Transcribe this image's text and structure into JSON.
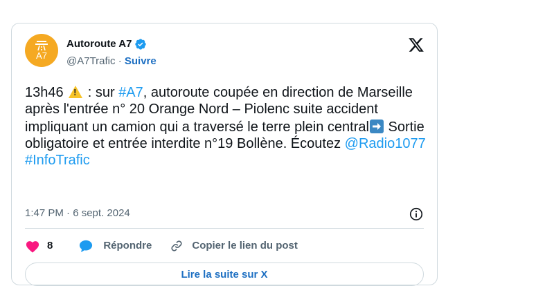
{
  "author": {
    "name": "Autoroute A7",
    "handle": "@A7Trafic",
    "separator": " · ",
    "follow_label": "Suivre",
    "avatar_text": "A7",
    "avatar_color": "#f5a922",
    "verified": true
  },
  "tweet": {
    "segments": [
      {
        "type": "text",
        "value": "13h46 "
      },
      {
        "type": "emoji",
        "icon": "warning-icon"
      },
      {
        "type": "text",
        "value": " : sur "
      },
      {
        "type": "link",
        "value": "#A7"
      },
      {
        "type": "text",
        "value": ", autoroute coupée en direction de Marseille après l'entrée n° 20 Orange Nord – Piolenc suite accident impliquant un camion qui a traversé le terre plein central"
      },
      {
        "type": "emoji",
        "icon": "right-arrow-icon"
      },
      {
        "type": "text",
        "value": " Sortie obligatoire et entrée interdite n°19 Bollène. Écoutez "
      },
      {
        "type": "link",
        "value": "@Radio1077"
      },
      {
        "type": "text",
        "value": " "
      },
      {
        "type": "link",
        "value": "#InfoTrafic"
      }
    ],
    "timestamp": "1:47 PM · 6 sept. 2024"
  },
  "actions": {
    "like_count": "8",
    "reply_label": "Répondre",
    "copy_link_label": "Copier le lien du post"
  },
  "read_more_label": "Lire la suite sur X",
  "colors": {
    "link": "#1d9bf0",
    "follow": "#1d6fc2",
    "like": "#f91880",
    "reply": "#1d9bf0",
    "border": "#cfd9de"
  }
}
